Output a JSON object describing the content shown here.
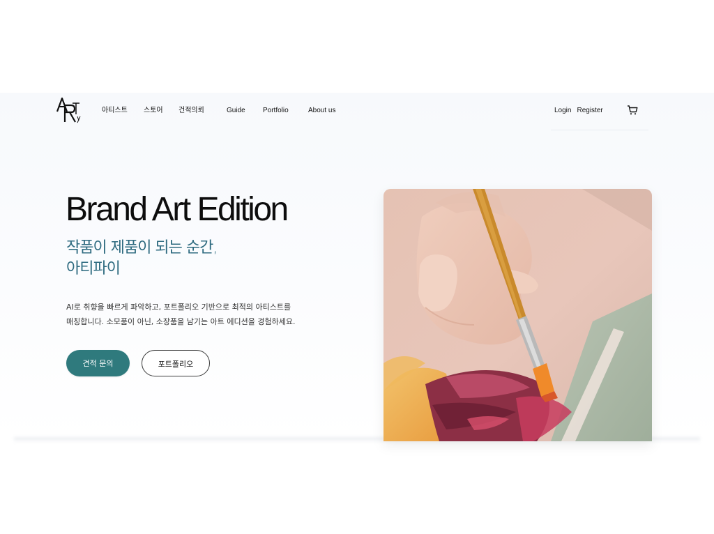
{
  "brand": {
    "logo_name": "Artify"
  },
  "nav": {
    "items": [
      {
        "label": "아티스트"
      },
      {
        "label": "스토어"
      },
      {
        "label": "건적의뢰"
      },
      {
        "label": "Guide"
      },
      {
        "label": "Portfolio"
      },
      {
        "label": "About us"
      }
    ]
  },
  "auth": {
    "login_label": "Login",
    "register_label": "Register"
  },
  "icons": {
    "cart": "cart-icon"
  },
  "hero": {
    "title": "Brand Art Edition",
    "subtitle_line1": "작품이 제품이 되는 순간,",
    "subtitle_line2": "아티파이",
    "description_line1": "AI로 취향을 빠르게 파악하고, 포트폴리오 기반으로 최적의 아티스트를",
    "description_line2": "매칭합니다. 소모품이 아닌, 소장품을 남기는 아트 에디션을 경험하세요.",
    "primary_button": "견적 문의",
    "secondary_button": "포트폴리오",
    "image_subject": "hand painting with a brush"
  },
  "colors": {
    "accent": "#2f7a7d",
    "subtitle": "#2e6b80",
    "text": "#111111",
    "panel": "#f7f9fc"
  }
}
